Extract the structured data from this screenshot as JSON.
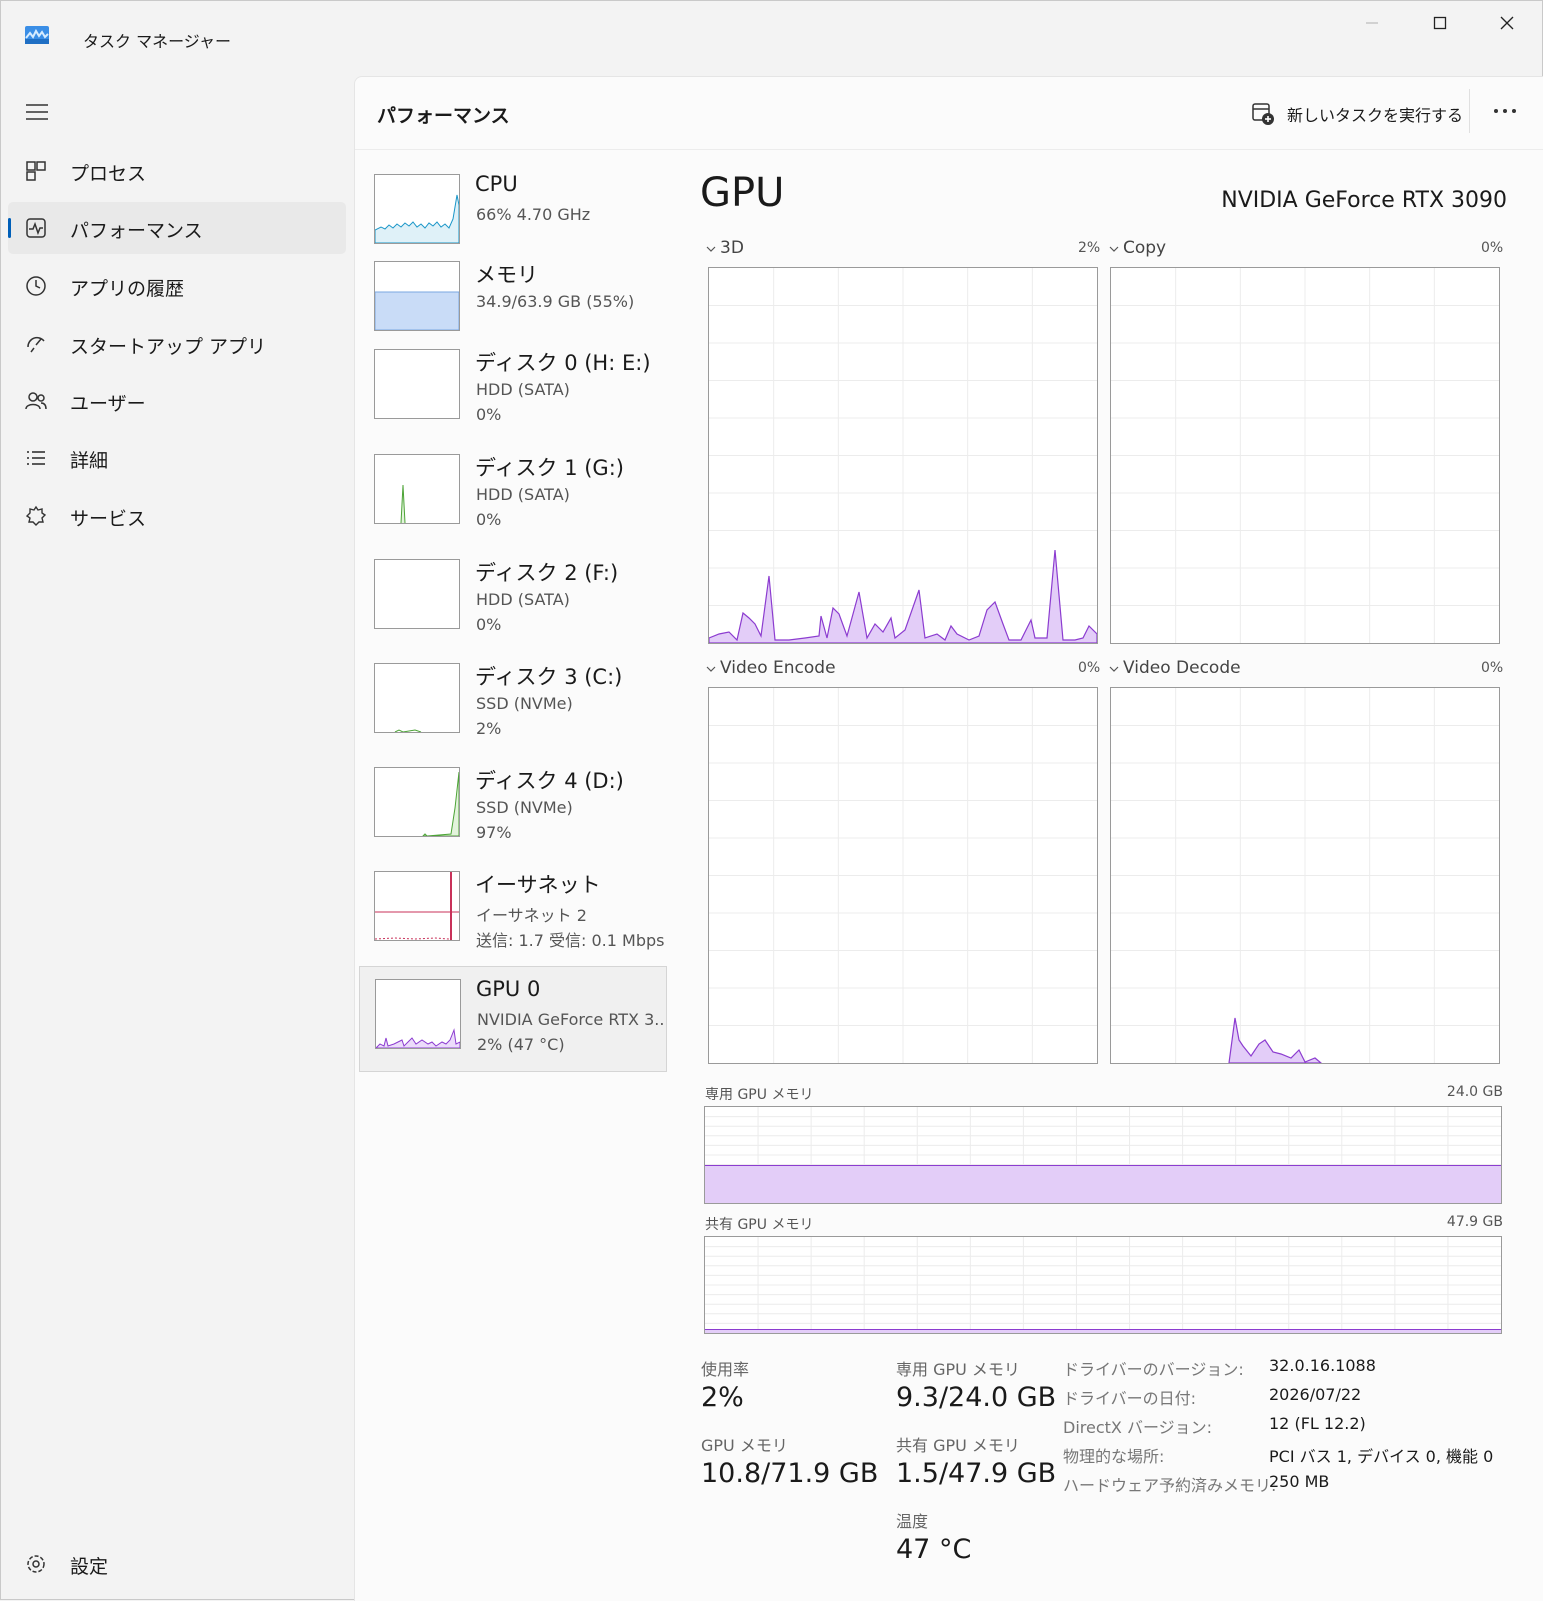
{
  "app": {
    "title": "タスク マネージャー"
  },
  "nav": {
    "items": [
      {
        "label": "プロセス",
        "icon": "process-icon"
      },
      {
        "label": "パフォーマンス",
        "icon": "performance-icon",
        "active": true
      },
      {
        "label": "アプリの履歴",
        "icon": "history-icon"
      },
      {
        "label": "スタートアップ アプリ",
        "icon": "startup-icon"
      },
      {
        "label": "ユーザー",
        "icon": "users-icon"
      },
      {
        "label": "詳細",
        "icon": "details-icon"
      },
      {
        "label": "サービス",
        "icon": "services-icon"
      }
    ],
    "settings_label": "設定"
  },
  "header": {
    "title": "パフォーマンス",
    "run_task_label": "新しいタスクを実行する"
  },
  "devices": [
    {
      "name": "CPU",
      "sub1": "66%  4.70 GHz",
      "sub2": "",
      "color": "#1a96c8"
    },
    {
      "name": "メモリ",
      "sub1": "34.9/63.9 GB (55%)",
      "sub2": "",
      "color": "#7aa7e0"
    },
    {
      "name": "ディスク 0 (H: E:)",
      "sub1": "HDD (SATA)",
      "sub2": "0%",
      "color": "#4ca336"
    },
    {
      "name": "ディスク 1 (G:)",
      "sub1": "HDD (SATA)",
      "sub2": "0%",
      "color": "#4ca336"
    },
    {
      "name": "ディスク 2 (F:)",
      "sub1": "HDD (SATA)",
      "sub2": "0%",
      "color": "#4ca336"
    },
    {
      "name": "ディスク 3 (C:)",
      "sub1": "SSD (NVMe)",
      "sub2": "2%",
      "color": "#4ca336"
    },
    {
      "name": "ディスク 4 (D:)",
      "sub1": "SSD (NVMe)",
      "sub2": "97%",
      "color": "#4ca336"
    },
    {
      "name": "イーサネット",
      "sub1": "イーサネット 2",
      "sub2": "送信: 1.7  受信: 0.1 Mbps",
      "color": "#c8325a"
    },
    {
      "name": "GPU 0",
      "sub1": "NVIDIA GeForce RTX 3...",
      "sub2": "2% (47 °C)",
      "color": "#8c3cd0",
      "selected": true
    }
  ],
  "gpu": {
    "title": "GPU",
    "model": "NVIDIA GeForce RTX 3090",
    "accent": "#8c3cd0",
    "engines": [
      {
        "label": "3D",
        "pct": "2%"
      },
      {
        "label": "Copy",
        "pct": "0%"
      },
      {
        "label": "Video Encode",
        "pct": "0%"
      },
      {
        "label": "Video Decode",
        "pct": "0%"
      }
    ],
    "dedicated_label": "専用 GPU メモリ",
    "dedicated_max": "24.0 GB",
    "shared_label": "共有 GPU メモリ",
    "shared_max": "47.9 GB",
    "stats": {
      "usage_label": "使用率",
      "usage": "2%",
      "dedicated_label": "専用 GPU メモリ",
      "dedicated": "9.3/24.0 GB",
      "gpu_mem_label": "GPU メモリ",
      "gpu_mem": "10.8/71.9 GB",
      "shared_label": "共有 GPU メモリ",
      "shared": "1.5/47.9 GB",
      "temp_label": "温度",
      "temp": "47 °C"
    },
    "info": [
      {
        "label": "ドライバーのバージョン:",
        "value": "32.0.16.1088"
      },
      {
        "label": "ドライバーの日付:",
        "value": "2026/07/22"
      },
      {
        "label": "DirectX バージョン:",
        "value": "12 (FL 12.2)"
      },
      {
        "label": "物理的な場所:",
        "value": "PCI バス 1, デバイス 0, 機能 0"
      },
      {
        "label": "ハードウェア予約済みメモリ:",
        "value": "250 MB"
      }
    ],
    "dedicated_level": 0.39,
    "shared_level": 0.03
  }
}
